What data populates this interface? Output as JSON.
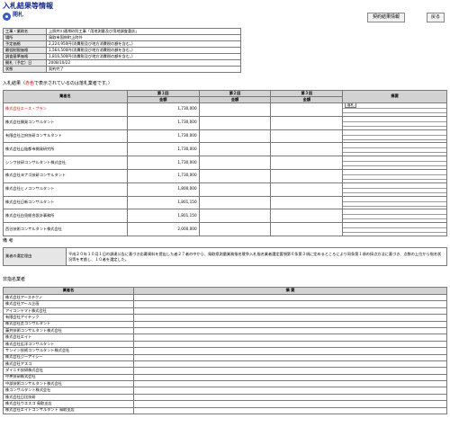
{
  "title": "入札結果等情報",
  "subtitle": "開札",
  "buttons": {
    "contract": "契約結果情報",
    "back": "戻る"
  },
  "info": [
    {
      "label": "工事・業務名",
      "value": "上照井川通常砂防工事「用地測量及び用地調査委託」"
    },
    {
      "label": "場所",
      "value": "鳥取市国府町上町外"
    },
    {
      "label": "予定価格",
      "value": "2,224,950円(消費税及び地方消費税の額を含む。)"
    },
    {
      "label": "最低制限価格",
      "value": "1,564,500円(消費税及び地方消費税の額を含む。)"
    },
    {
      "label": "調査基準価格",
      "value": "1,816,500円(消費税及び地方消費税の額を含む。)"
    },
    {
      "label": "開札（予定）日",
      "value": "2008/10/22"
    },
    {
      "label": "状態",
      "value": "契約完了"
    }
  ],
  "bid": {
    "caption": "入札結果（",
    "caption_red": "赤色",
    "caption_rest": "で表示されているのは落札業者です。）",
    "col_name": "業者名",
    "col_r1": "第１回",
    "col_r2": "第２回",
    "col_r3": "第３回",
    "col_amount": "金額",
    "col_remarks": "摘要",
    "rows": [
      {
        "name": "株式会社エース・プラン",
        "amount": "1,730,000",
        "remark": "落札"
      },
      {
        "name": "株式会社開発コンサルタント",
        "amount": "1,730,000",
        "remark": ""
      },
      {
        "name": "有限会社江府技研コンサルタント",
        "amount": "1,730,000",
        "remark": ""
      },
      {
        "name": "株式会社山陰都市開発研究所",
        "amount": "1,730,000",
        "remark": ""
      },
      {
        "name": "シンワ技研コンサルタント株式会社",
        "amount": "1,730,000",
        "remark": ""
      },
      {
        "name": "株式会社ヨナゴ技研コンサルタント",
        "amount": "1,730,000",
        "remark": ""
      },
      {
        "name": "株式会社ヒノコンサルタント",
        "amount": "1,800,000",
        "remark": ""
      },
      {
        "name": "株式会社日新コンサルタント",
        "amount": "1,801,150",
        "remark": ""
      },
      {
        "name": "株式会社白兎総合設計事務所",
        "amount": "1,801,150",
        "remark": ""
      },
      {
        "name": "西谷技術コンサルタント株式会社",
        "amount": "2,000,000",
        "remark": ""
      }
    ]
  },
  "notes": {
    "heading": "備 考",
    "label": "業者の選定理由",
    "text": "平成２０年１０月１日の調達公告に基づき応募資料を提出した者２７者の中から、鳥取県測量業務指名競争入札指名業者選定要領第６条第３項に定めるところにより同条第１項の採点方法に基づき、点数の上位から指名状況等を考慮し、１０者を選定した。"
  },
  "invited": {
    "heading": "非指名業者",
    "col_name": "業者名",
    "col_remarks": "摘 要",
    "rows": [
      "株式会社アーステクノ",
      "株式会社アール企画",
      "アイコンヤマト株式会社",
      "有限会社アイテック",
      "株式会社荒コンサルタント",
      "藤井技術コンサルタント株式会社",
      "株式会社エイト",
      "株式会社広洋コンサルタント",
      "サンイン技術コンサルタント株式会社",
      "株式会社ジーアイシー",
      "株式会社アスコ",
      "ダイニチ技研株式会社",
      "中央技研株式会社",
      "中部技術コンサルタント株式会社",
      "株コンサルタント株式会社",
      "株式会社日比技研",
      "株式会社ウエスコ 鳥取支店",
      "株式会社エイトコンサルタント 鳥取支店"
    ]
  }
}
